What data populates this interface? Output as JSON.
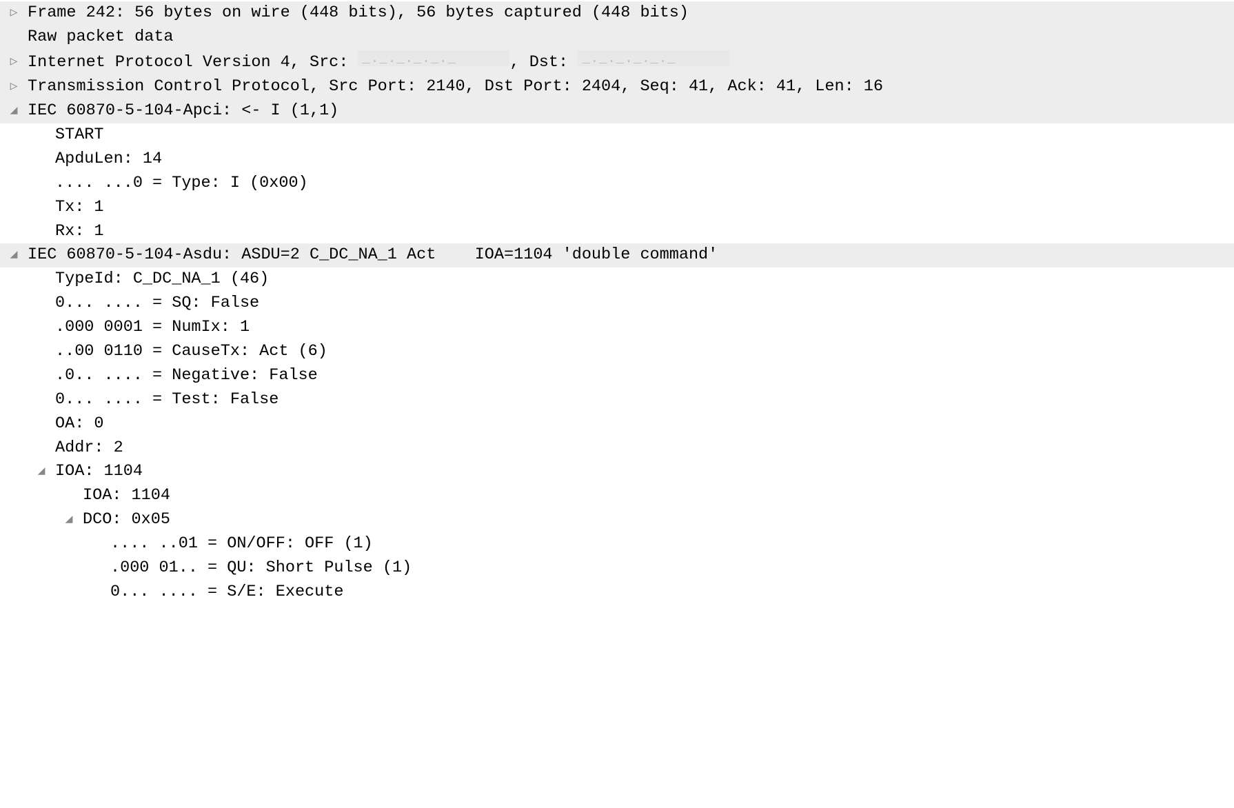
{
  "icons": {
    "collapsed": "▷",
    "expanded": "◢"
  },
  "rows": {
    "frame": "Frame 242: 56 bytes on wire (448 bits), 56 bytes captured (448 bits)",
    "raw": "Raw packet data",
    "ip_prefix": "Internet Protocol Version 4, Src: ",
    "ip_mid": ", Dst: ",
    "tcp": "Transmission Control Protocol, Src Port: 2140, Dst Port: 2404, Seq: 41, Ack: 41, Len: 16",
    "apci": "IEC 60870-5-104-Apci: <- I (1,1)",
    "apci_start": "START",
    "apci_len": "ApduLen: 14",
    "apci_type": ".... ...0 = Type: I (0x00)",
    "apci_tx": "Tx: 1",
    "apci_rx": "Rx: 1",
    "asdu": "IEC 60870-5-104-Asdu: ASDU=2 C_DC_NA_1 Act    IOA=1104 'double command'",
    "asdu_typeid": "TypeId: C_DC_NA_1 (46)",
    "asdu_sq": "0... .... = SQ: False",
    "asdu_numix": ".000 0001 = NumIx: 1",
    "asdu_cause": "..00 0110 = CauseTx: Act (6)",
    "asdu_neg": ".0.. .... = Negative: False",
    "asdu_test": "0... .... = Test: False",
    "asdu_oa": "OA: 0",
    "asdu_addr": "Addr: 2",
    "ioa_hdr": "IOA: 1104",
    "ioa_val": "IOA: 1104",
    "dco_hdr": "DCO: 0x05",
    "dco_onoff": ".... ..01 = ON/OFF: OFF (1)",
    "dco_qu": ".000 01.. = QU: Short Pulse (1)",
    "dco_se": "0... .... = S/E: Execute"
  }
}
